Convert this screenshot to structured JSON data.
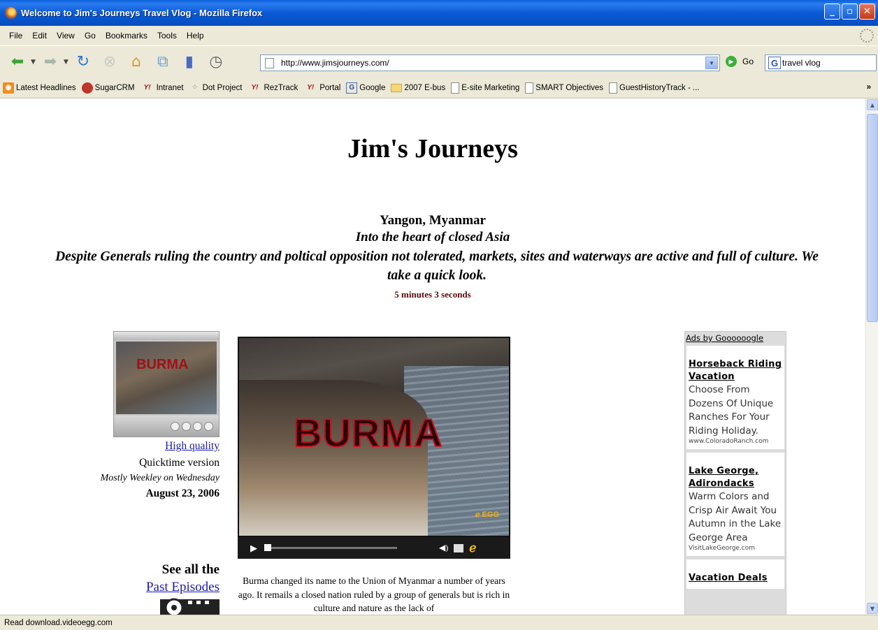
{
  "window": {
    "title": "Welcome to Jim's Journeys Travel Vlog - Mozilla Firefox"
  },
  "menu": [
    "File",
    "Edit",
    "View",
    "Go",
    "Bookmarks",
    "Tools",
    "Help"
  ],
  "toolbar": {
    "url": "http://www.jimsjourneys.com/",
    "go_label": "Go",
    "search_value": "travel vlog"
  },
  "bookmarks": [
    {
      "label": "Latest Headlines",
      "icon": "rss-icon"
    },
    {
      "label": "SugarCRM",
      "icon": "sugarcrm-icon"
    },
    {
      "label": "Intranet",
      "icon": "yahoo-icon"
    },
    {
      "label": "Dot Project",
      "icon": "dots-icon"
    },
    {
      "label": "RezTrack",
      "icon": "yahoo-icon"
    },
    {
      "label": "Portal",
      "icon": "yahoo-icon"
    },
    {
      "label": "Google",
      "icon": "google-icon"
    },
    {
      "label": "2007 E-bus",
      "icon": "folder-icon"
    },
    {
      "label": "E-site Marketing",
      "icon": "page-icon"
    },
    {
      "label": "SMART Objectives",
      "icon": "page-icon"
    },
    {
      "label": "GuestHistoryTrack - ...",
      "icon": "page-icon"
    }
  ],
  "page": {
    "site_title": "Jim's Journeys",
    "episode": {
      "place": "Yangon, Myanmar",
      "tagline": "Into the heart of closed Asia",
      "description": "Despite Generals ruling the country and poltical opposition not tolerated, markets, sites and waterways are active and full of culture. We take a quick look.",
      "length": "5 minutes 3 seconds"
    },
    "thumbnail_label": "BURMA",
    "video_label": "BURMA",
    "high_quality": "High quality",
    "quicktime": "Quicktime version",
    "schedule": "Mostly Weekley on Wednesday",
    "date": "August 23, 2006",
    "see_all": "See all the",
    "past_episodes": "Past Episodes",
    "caption": "Burma changed its name to the Union of Myanmar a number of years ago. It remails a closed nation ruled by a group of generals but is rich in culture and nature as the lack of"
  },
  "ads": {
    "header": "Ads by Goooooogle",
    "items": [
      {
        "title": "Horseback Riding Vacation",
        "body": "Choose From Dozens Of Unique Ranches For Your Riding Holiday.",
        "url": "www.ColoradoRanch.com"
      },
      {
        "title": "Lake George, Adirondacks",
        "body": "Warm Colors and Crisp Air Await You Autumn in the Lake George Area",
        "url": "VisitLakeGeorge.com"
      },
      {
        "title": "Vacation Deals",
        "body": "",
        "url": ""
      }
    ]
  },
  "status": "Read download.videoegg.com"
}
